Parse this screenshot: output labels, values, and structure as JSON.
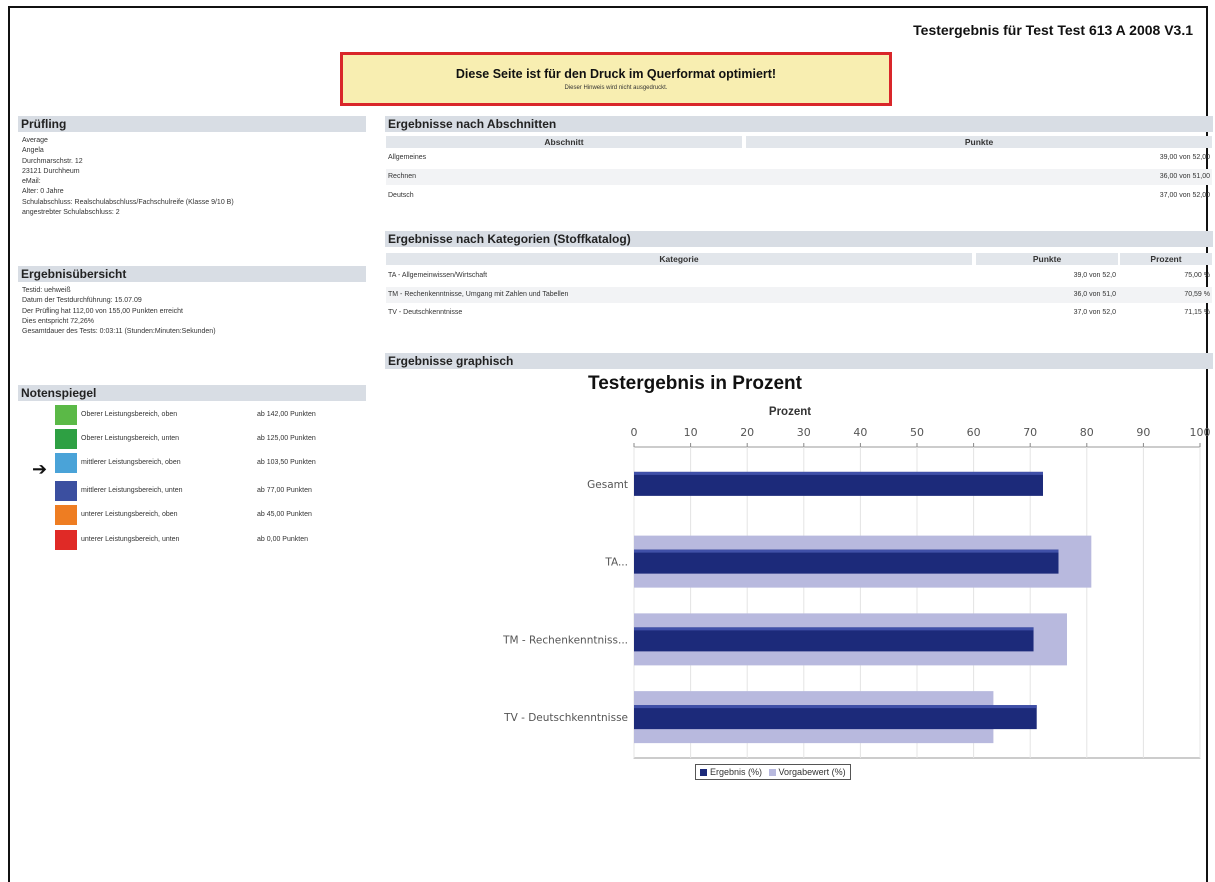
{
  "page_title": "Testergebnis für Test Test 613 A 2008 V3.1",
  "notice": {
    "main": "Diese Seite ist für den Druck im Querformat optimiert!",
    "sub": "Dieser Hinweis wird nicht ausgedruckt."
  },
  "pruefling": {
    "heading": "Prüfling",
    "lines": [
      "Average",
      "Angela",
      "Durchmarschstr. 12",
      "23121 Durchheum",
      "eMail:",
      "Alter: 0 Jahre",
      "Schulabschluss:  Realschulabschluss/Fachschulreife (Klasse 9/10 B)",
      "angestrebter Schulabschluss: 2"
    ]
  },
  "uebersicht": {
    "heading": "Ergebnisübersicht",
    "lines": [
      "Testid: uehweiß",
      "Datum der Testdurchführung: 15.07.09",
      "Der Prüfling hat 112,00 von 155,00 Punkten erreicht",
      "Dies entspricht 72,26%",
      "Gesamtdauer des Tests: 0:03:11 (Stunden:Minuten:Sekunden)"
    ]
  },
  "notenspiegel": {
    "heading": "Notenspiegel",
    "rows": [
      {
        "label": "Oberer Leistungsbereich, oben",
        "points": "ab 142,00 Punkten",
        "color": "#5bb947"
      },
      {
        "label": "Oberer Leistungsbereich, unten",
        "points": "ab 125,00 Punkten",
        "color": "#2ea043"
      },
      {
        "label": "mittlerer Leistungsbereich, oben",
        "points": "ab 103,50 Punkten",
        "color": "#4aa3d8"
      },
      {
        "label": "mittlerer Leistungsbereich, unten",
        "points": "ab 77,00 Punkten",
        "color": "#3b4fa0"
      },
      {
        "label": "unterer Leistungsbereich, oben",
        "points": "ab 45,00 Punkten",
        "color": "#ee7d22"
      },
      {
        "label": "unterer Leistungsbereich, unten",
        "points": "ab 0,00 Punkten",
        "color": "#e02a26"
      }
    ]
  },
  "abschnitte": {
    "heading": "Ergebnisse nach Abschnitten",
    "col_section": "Abschnitt",
    "col_points": "Punkte",
    "rows": [
      {
        "name": "Allgemeines",
        "points": "39,00 von 52,00"
      },
      {
        "name": "Rechnen",
        "points": "36,00 von 51,00"
      },
      {
        "name": "Deutsch",
        "points": "37,00 von 52,00"
      }
    ]
  },
  "kategorien": {
    "heading": "Ergebnisse nach Kategorien (Stoffkatalog)",
    "col_category": "Kategorie",
    "col_points": "Punkte",
    "col_percent": "Prozent",
    "rows": [
      {
        "name": "TA - Allgemeinwissen/Wirtschaft",
        "points": "39,0 von 52,0",
        "percent": "75,00 %"
      },
      {
        "name": "TM - Rechenkenntnisse, Umgang mit Zahlen und Tabellen",
        "points": "36,0 von 51,0",
        "percent": "70,59 %"
      },
      {
        "name": "TV - Deutschkenntnisse",
        "points": "37,0 von 52,0",
        "percent": "71,15 %"
      }
    ]
  },
  "graphisch": {
    "heading": "Ergebnisse graphisch"
  },
  "legend": {
    "ergebnis": "Ergebnis (%)",
    "vorgabe": "Vorgabewert (%)"
  },
  "colors": {
    "ergebnis": "#1c2a7a",
    "vorgabe": "#b8b9de",
    "section_header": "#d8dde4",
    "notice_border": "#d9262a",
    "notice_bg": "#f8eeb1"
  },
  "chart_data": {
    "type": "bar",
    "orientation": "horizontal",
    "title": "Testergebnis in Prozent",
    "xlabel": "Prozent",
    "ylabel": "",
    "xlim": [
      0,
      100
    ],
    "xticks": [
      0,
      10,
      20,
      30,
      40,
      50,
      60,
      70,
      80,
      90,
      100
    ],
    "categories": [
      "Gesamt",
      "TA...",
      "TM - Rechenkenntniss...",
      "TV - Deutschkenntnisse"
    ],
    "series": [
      {
        "name": "Ergebnis (%)",
        "values": [
          72.26,
          75.0,
          70.59,
          71.15
        ]
      },
      {
        "name": "Vorgabewert (%)",
        "values": [
          null,
          80.8,
          76.5,
          63.5
        ]
      }
    ],
    "grid": true,
    "legend": "bottom"
  }
}
